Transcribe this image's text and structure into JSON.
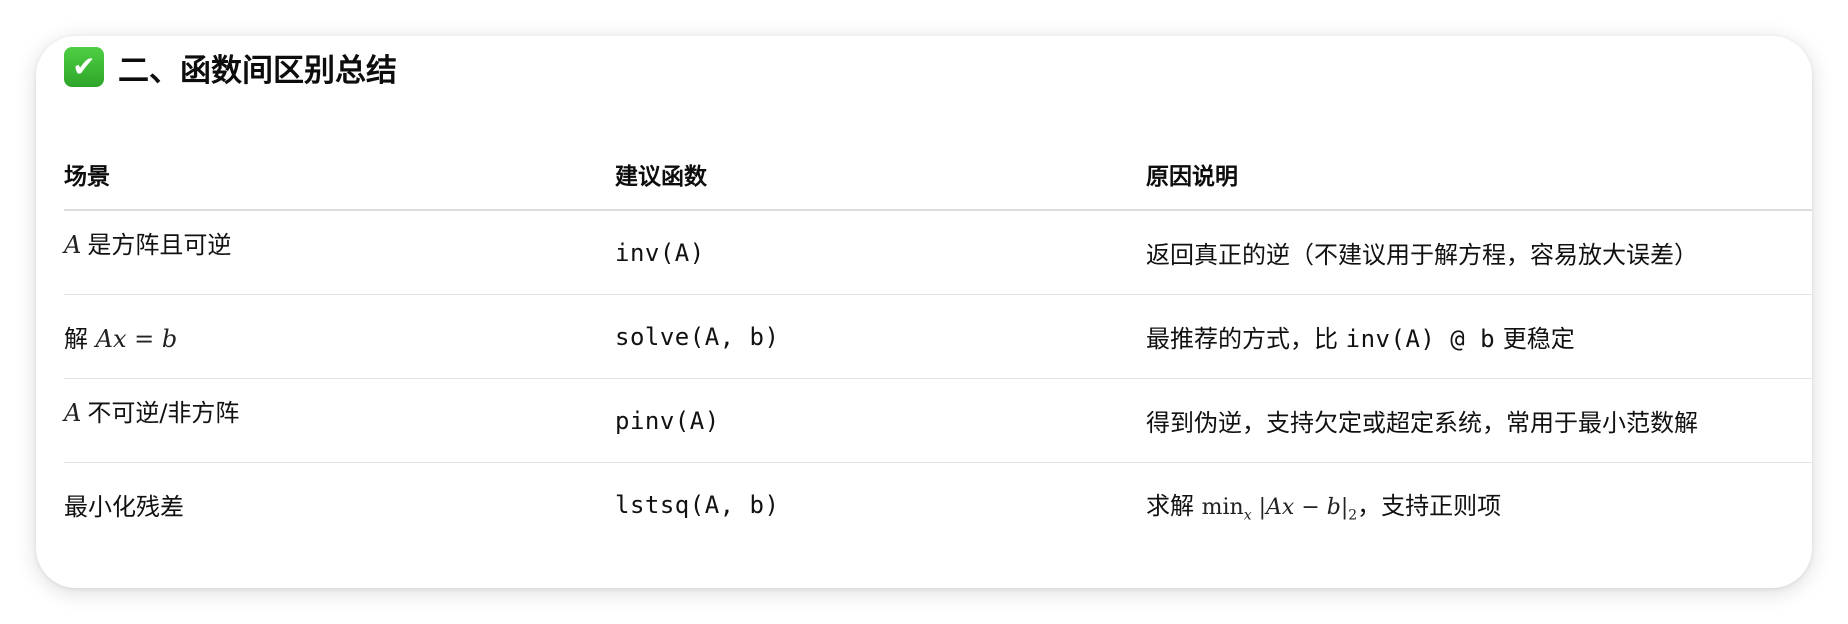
{
  "heading": {
    "icon": "check-mark-button-icon",
    "title": "二、函数间区别总结"
  },
  "table": {
    "headers": {
      "scene": "场景",
      "function": "建议函数",
      "reason": "原因说明"
    },
    "rows": [
      {
        "scene_math": "A",
        "scene_text": "是方阵且可逆",
        "function": "inv(A)",
        "reason_text": "返回真正的逆（不建议用于解方程，容易放大误差）"
      },
      {
        "scene_text": "解",
        "scene_math": "Ax = b",
        "function": "solve(A, b)",
        "reason_pre": "最推荐的方式，比",
        "reason_code": "inv(A) @ b",
        "reason_post": "更稳定"
      },
      {
        "scene_math": "A",
        "scene_text": "不可逆/非方阵",
        "function": "pinv(A)",
        "reason_text": "得到伪逆，支持欠定或超定系统，常用于最小范数解"
      },
      {
        "scene_text": "最小化残差",
        "function": "lstsq(A, b)",
        "reason_pre": "求解",
        "reason_math_min": "min",
        "reason_math_sub": "x",
        "reason_math_expr": "|Ax − b|",
        "reason_math_norm": "2",
        "reason_post": "，支持正则项"
      }
    ]
  }
}
